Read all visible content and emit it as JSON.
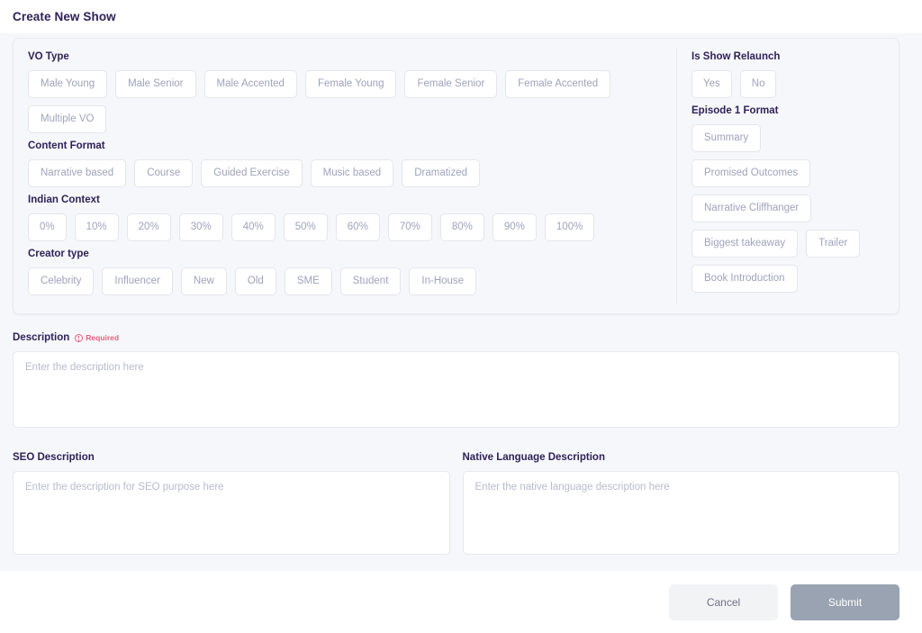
{
  "header": {
    "title": "Create New Show"
  },
  "form": {
    "left_sections": [
      {
        "label": "VO Type",
        "options": [
          "Male Young",
          "Male Senior",
          "Male Accented",
          "Female Young",
          "Female Senior",
          "Female Accented",
          "Multiple VO"
        ]
      },
      {
        "label": "Content Format",
        "options": [
          "Narrative based",
          "Course",
          "Guided Exercise",
          "Music based",
          "Dramatized"
        ]
      },
      {
        "label": "Indian Context",
        "options": [
          "0%",
          "10%",
          "20%",
          "30%",
          "40%",
          "50%",
          "60%",
          "70%",
          "80%",
          "90%",
          "100%"
        ]
      },
      {
        "label": "Creator type",
        "options": [
          "Celebrity",
          "Influencer",
          "New",
          "Old",
          "SME",
          "Student",
          "In-House"
        ]
      }
    ],
    "right_sections": [
      {
        "label": "Is Show Relaunch",
        "options": [
          "Yes",
          "No"
        ]
      },
      {
        "label": "Episode 1 Format",
        "options": [
          "Summary",
          "Promised Outcomes",
          "Narrative Cliffhanger",
          "Biggest takeaway",
          "Trailer",
          "Book Introduction"
        ]
      }
    ],
    "description": {
      "label": "Description",
      "required_text": "Required",
      "required_icon": "info-circle-icon",
      "placeholder": "Enter the description here",
      "value": ""
    },
    "seo_description": {
      "label": "SEO Description",
      "placeholder": "Enter the description for SEO purpose here",
      "value": ""
    },
    "native_description": {
      "label": "Native Language Description",
      "placeholder": "Enter the native language description here",
      "value": ""
    }
  },
  "footer": {
    "cancel_label": "Cancel",
    "submit_label": "Submit"
  },
  "colors": {
    "label_text": "#2f2257",
    "chip_text": "#9ea3bd",
    "chip_border": "#e4e6ef",
    "required_red": "#e8617d",
    "body_bg": "#f6f7fb",
    "submit_bg": "#9aa3b2",
    "cancel_bg": "#f2f3f5"
  }
}
